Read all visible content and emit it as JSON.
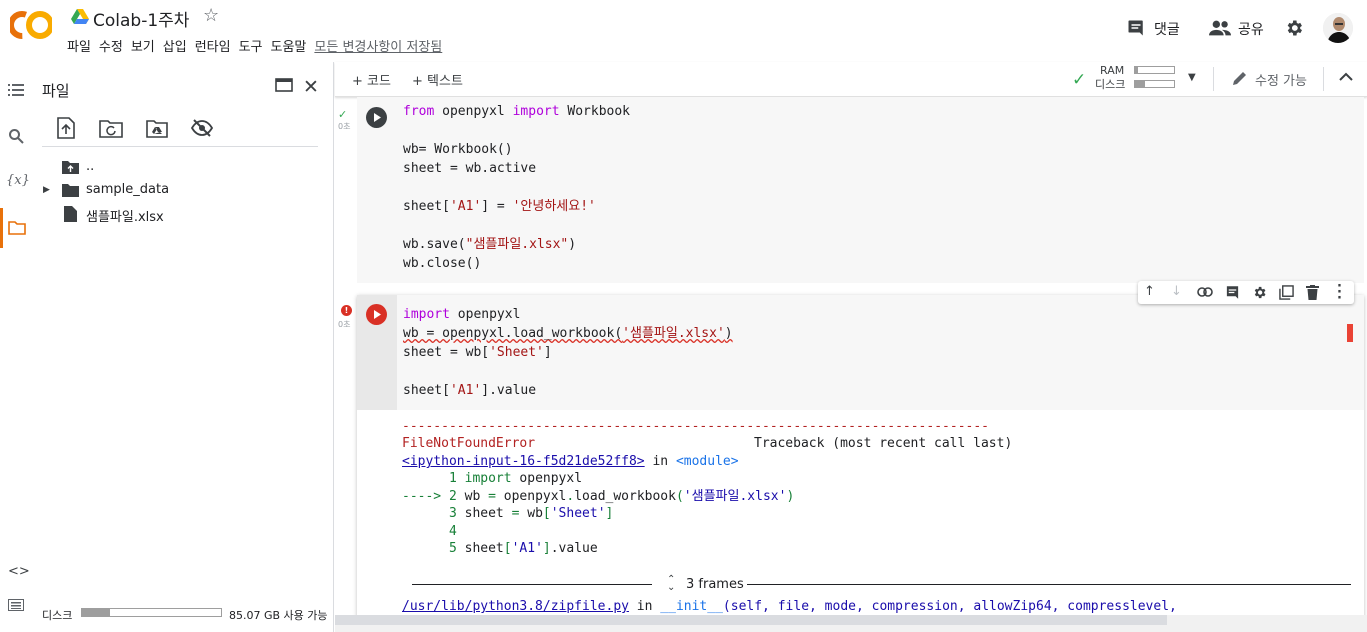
{
  "header": {
    "title": "Colab-1주차",
    "menu": [
      "파일",
      "수정",
      "보기",
      "삽입",
      "런타임",
      "도구",
      "도움말"
    ],
    "save_status": "모든 변경사항이 저장됨",
    "comment_label": "댓글",
    "share_label": "공유"
  },
  "sidebar": {
    "title": "파일",
    "files": [
      {
        "name": "..",
        "icon": "folder-up-icon"
      },
      {
        "name": "sample_data",
        "icon": "folder-icon"
      },
      {
        "name": "샘플파일.xlsx",
        "icon": "file-icon"
      }
    ],
    "disk_label": "디스크",
    "disk_free": "85.07 GB 사용 가능",
    "disk_used_fraction": 0.2
  },
  "toolbar": {
    "code_label": "+ 코드",
    "text_label": "+ 텍스트",
    "ram_label": "RAM",
    "disk_label": "디스크",
    "edit_label": "수정 가능"
  },
  "cells": [
    {
      "status": "success",
      "exec_time": "0초"
    },
    {
      "status": "error",
      "exec_time": "0초"
    }
  ],
  "output": {
    "dash_line": "---------------------------------------------------------------------------",
    "error_name": "FileNotFoundError",
    "traceback_header": "Traceback (most recent call last)",
    "input_link": "<ipython-input-16-f5d21de52ff8>",
    "in_text": " in ",
    "module_text": "<module>",
    "frames_label": "3 frames",
    "zip_path": "/usr/lib/python3.8/zipfile.py",
    "init_text": "__init__",
    "init_args": "(self, file, mode, compression, allowZip64, compresslevel,"
  },
  "colors": {
    "accent_orange": "#F9AB00",
    "accent_orange_dark": "#E8710A",
    "success_green": "#34A853",
    "error_red": "#D93025"
  }
}
